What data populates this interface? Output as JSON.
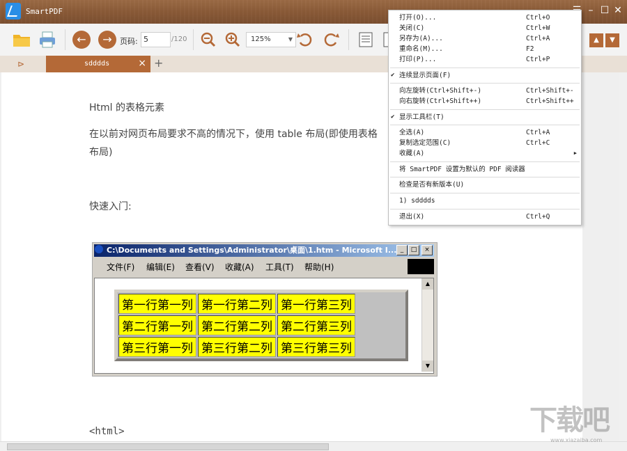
{
  "app": {
    "title": "SmartPDF"
  },
  "window_controls": {
    "menu_icon": "menu-icon",
    "minimize": "minimize-icon",
    "maximize": "maximize-icon",
    "close": "close-icon"
  },
  "toolbar": {
    "page_label": "页码:",
    "page_value": "5",
    "page_total": "/120",
    "zoom_value": "125%"
  },
  "tabs": [
    {
      "title": "sdddds"
    }
  ],
  "document": {
    "lines": [
      "Html 的表格元素",
      "在以前对网页布局要求不高的情况下，使用 table 布局(即使用表格",
      "布局)",
      "快速入门:",
      "<html>"
    ],
    "embedded_screenshot": {
      "title": "C:\\Documents and Settings\\Administrator\\桌面\\1.htm - Microsoft I...",
      "menu": [
        "文件(F)",
        "编辑(E)",
        "查看(V)",
        "收藏(A)",
        "工具(T)",
        "帮助(H)"
      ],
      "table": [
        [
          "第一行第一列",
          "第一行第二列",
          "第一行第三列"
        ],
        [
          "第二行第一列",
          "第二行第二列",
          "第二行第三列"
        ],
        [
          "第三行第一列",
          "第三行第二列",
          "第三行第三列"
        ]
      ]
    }
  },
  "context_menu": {
    "items": [
      {
        "label": "打开(O)...",
        "shortcut": "Ctrl+O"
      },
      {
        "label": "关闭(C)",
        "shortcut": "Ctrl+W"
      },
      {
        "label": "另存为(A)...",
        "shortcut": "Ctrl+A"
      },
      {
        "label": "重命名(M)...",
        "shortcut": "F2"
      },
      {
        "label": "打印(P)...",
        "shortcut": "Ctrl+P"
      },
      {
        "label": "连续显示页面(F)",
        "shortcut": "",
        "checked": true
      },
      {
        "label": "向左旋转(Ctrl+Shift+-)",
        "shortcut": "Ctrl+Shift+-"
      },
      {
        "label": "向右旋转(Ctrl+Shift++)",
        "shortcut": "Ctrl+Shift++"
      },
      {
        "label": "显示工具栏(T)",
        "shortcut": "",
        "checked": true
      },
      {
        "label": "全选(A)",
        "shortcut": "Ctrl+A"
      },
      {
        "label": "复制选定范围(C)",
        "shortcut": "Ctrl+C"
      },
      {
        "label": "收藏(A)",
        "shortcut": "",
        "submenu": true
      },
      {
        "label": "将 SmartPDF 设置为默认的 PDF 阅读器",
        "shortcut": ""
      },
      {
        "label": "检查是否有新版本(U)",
        "shortcut": ""
      },
      {
        "label": "1) sdddds",
        "shortcut": ""
      },
      {
        "label": "退出(X)",
        "shortcut": "Ctrl+Q"
      }
    ]
  },
  "watermark": {
    "text": "下载吧",
    "url": "www.xiazaiba.com"
  },
  "colors": {
    "accent": "#b46937",
    "titlebar": "#8a5a37"
  }
}
